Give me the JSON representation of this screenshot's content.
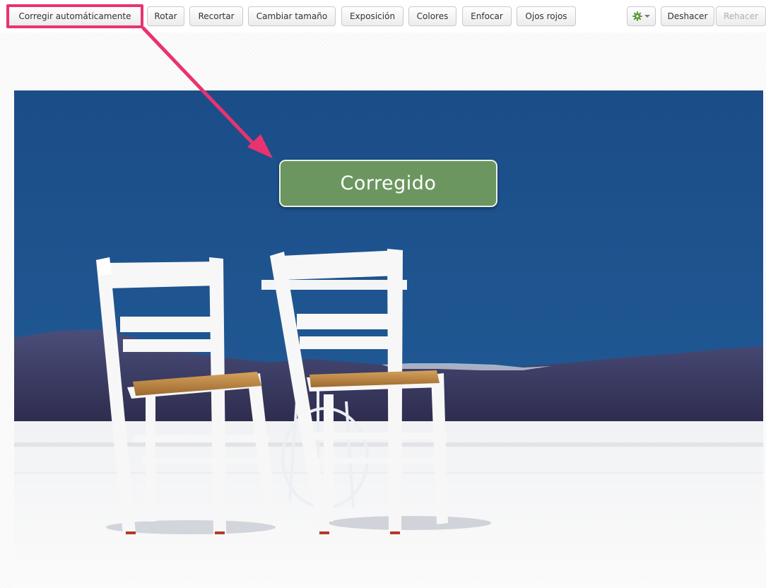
{
  "toolbar": {
    "auto_fix": "Corregir automáticamente",
    "rotate": "Rotar",
    "crop": "Recortar",
    "resize": "Cambiar tamaño",
    "exposure": "Exposición",
    "colors": "Colores",
    "sharpen": "Enfocar",
    "red_eye": "Ojos rojos",
    "settings_icon": "gear-icon",
    "settings_dropdown_icon": "chevron-down-icon",
    "undo": "Deshacer",
    "redo": "Rehacer"
  },
  "overlay": {
    "status": "Corregido"
  },
  "colors": {
    "highlight": "#e8336f",
    "status_badge": "#6b9660",
    "sky": "#1d4f87"
  }
}
